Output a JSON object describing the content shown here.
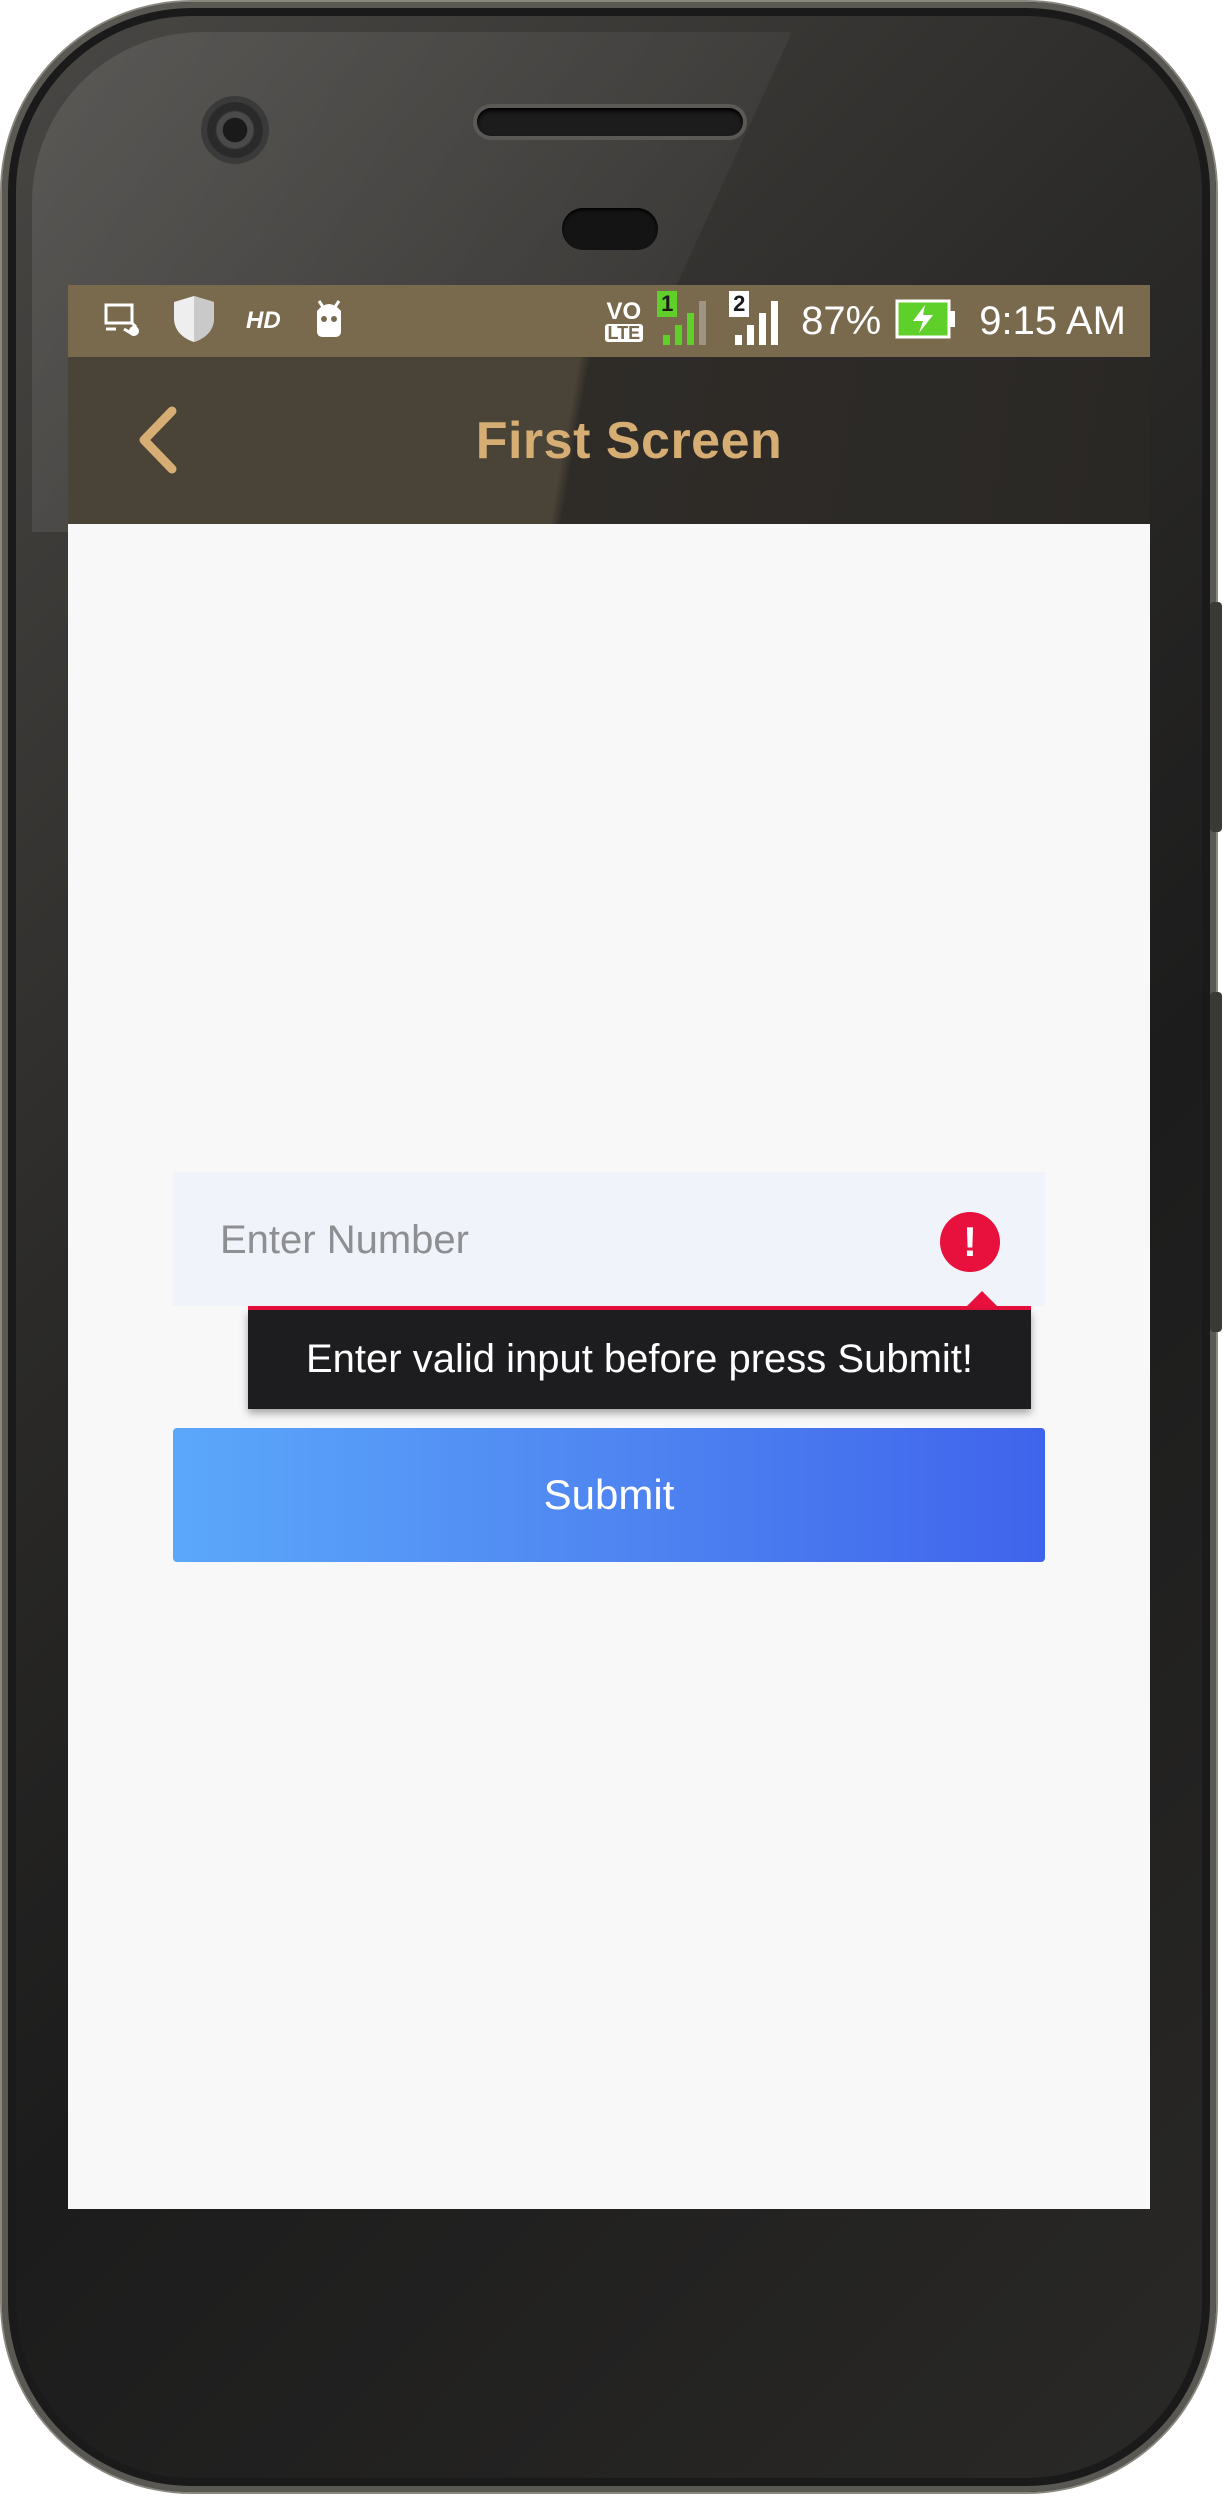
{
  "status_bar": {
    "hd_label": "HD",
    "volte_label_top": "VO",
    "volte_label_bottom": "LTE",
    "sim1_label": "1",
    "sim2_label": "2",
    "battery_percent": "87%",
    "time": "9:15 AM",
    "battery_level": 0.87,
    "battery_color": "#5fcf2a",
    "sim1_color": "#5fcf2a"
  },
  "app_bar": {
    "title": "First Screen",
    "back_icon": "chevron-left-icon",
    "accent_color": "#d6ad72"
  },
  "form": {
    "number_input": {
      "value": "",
      "placeholder": "Enter Number"
    },
    "error_icon": "exclamation-icon",
    "error_message": "Enter valid input before press Submit!",
    "error_color": "#e8103c",
    "submit_label": "Submit"
  }
}
